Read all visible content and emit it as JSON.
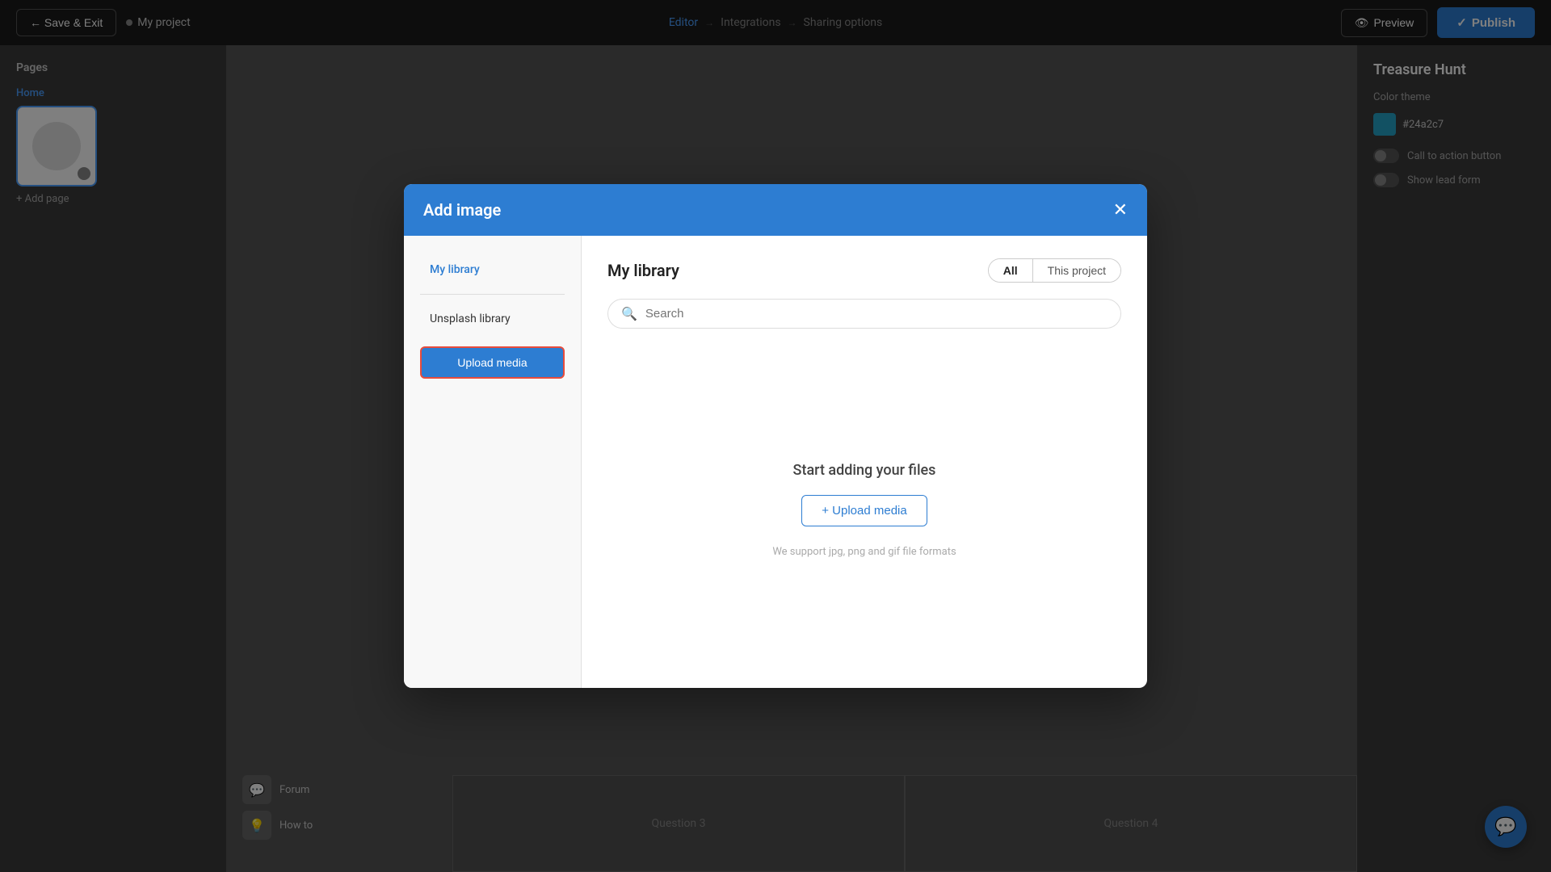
{
  "topNav": {
    "saveExit": "← Save & Exit",
    "projectName": "My project",
    "steps": [
      {
        "label": "Editor",
        "active": true
      },
      {
        "label": "Integrations",
        "active": false
      },
      {
        "label": "Sharing options",
        "active": false
      }
    ],
    "preview": "Preview",
    "publish": "Publish"
  },
  "leftSidebar": {
    "title": "Pages",
    "pages": [
      {
        "label": "Home"
      }
    ],
    "addPage": "+ Add page"
  },
  "rightSidebar": {
    "projectTitle": "Treasure Hunt",
    "colorThemeLabel": "Color theme",
    "colorHex": "#24a2c7",
    "toggles": [
      {
        "label": "Call to action button"
      },
      {
        "label": "Show lead form"
      }
    ]
  },
  "bottomItems": [
    {
      "icon": "💬",
      "label": "Forum"
    },
    {
      "icon": "💡",
      "label": "How to"
    }
  ],
  "questionCards": [
    {
      "label": "Question 3"
    },
    {
      "label": "Question 4"
    }
  ],
  "modal": {
    "title": "Add image",
    "closeIcon": "✕",
    "sidebar": {
      "myLibrary": "My library",
      "unsplashLibrary": "Unsplash library",
      "uploadMediaBtn": "Upload media"
    },
    "main": {
      "title": "My library",
      "filterAll": "All",
      "filterThisProject": "This project",
      "searchPlaceholder": "Search",
      "emptyTitle": "Start adding your files",
      "uploadMediaBtn": "+ Upload media",
      "supportText": "We support jpg, png and gif file formats"
    }
  },
  "chatBubble": {
    "icon": "💬"
  }
}
